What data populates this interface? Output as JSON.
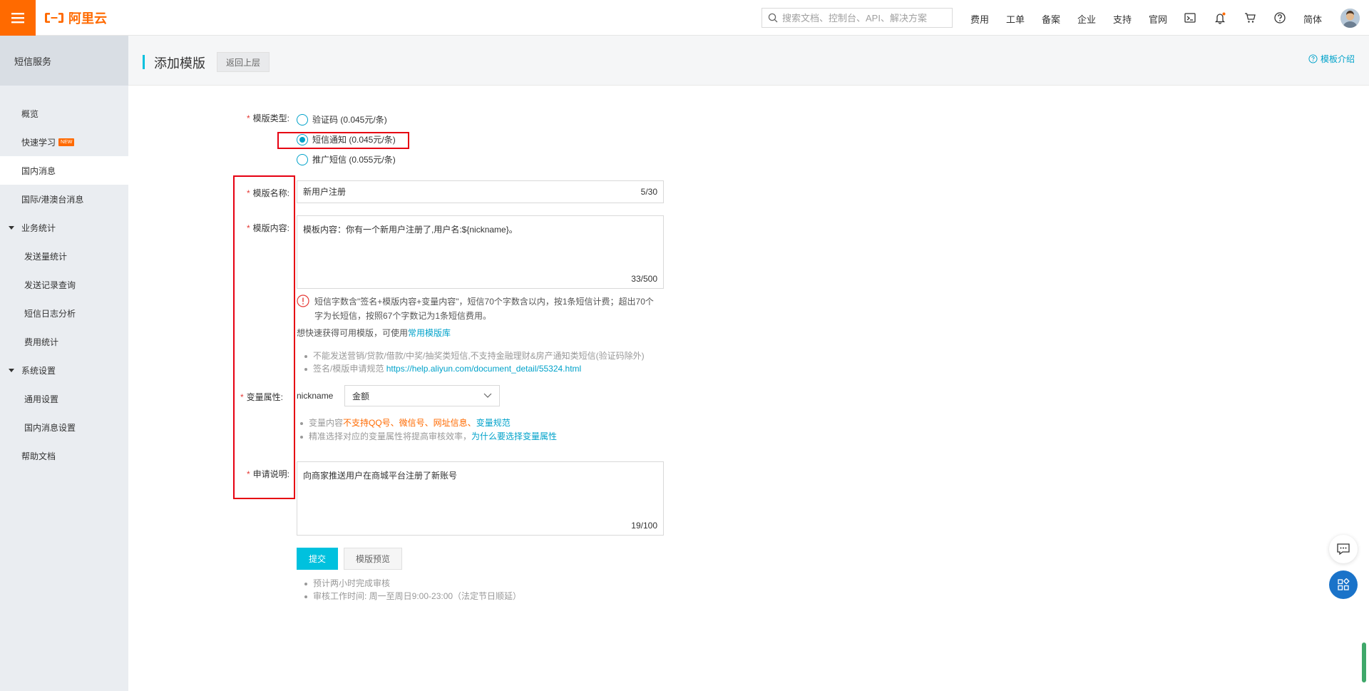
{
  "topbar": {
    "logo_text": "阿里云",
    "search_placeholder": "搜索文档、控制台、API、解决方案",
    "nav": [
      "费用",
      "工单",
      "备案",
      "企业",
      "支持",
      "官网"
    ],
    "lang": "简体"
  },
  "sidebar": {
    "title": "短信服务",
    "items": [
      {
        "label": "概览"
      },
      {
        "label": "快速学习",
        "badge": "NEW"
      },
      {
        "label": "国内消息"
      },
      {
        "label": "国际/港澳台消息"
      },
      {
        "label": "业务统计"
      },
      {
        "label": "发送量统计"
      },
      {
        "label": "发送记录查询"
      },
      {
        "label": "短信日志分析"
      },
      {
        "label": "费用统计"
      },
      {
        "label": "系统设置"
      },
      {
        "label": "通用设置"
      },
      {
        "label": "国内消息设置"
      },
      {
        "label": "帮助文档"
      }
    ]
  },
  "header": {
    "title": "添加模版",
    "back_label": "返回上层",
    "intro_label": "模板介绍"
  },
  "form": {
    "type_label": "模版类型:",
    "types": [
      {
        "label": "验证码 (0.045元/条)",
        "checked": false
      },
      {
        "label": "短信通知 (0.045元/条)",
        "checked": true
      },
      {
        "label": "推广短信 (0.055元/条)",
        "checked": false
      }
    ],
    "name_label": "模版名称:",
    "name_value": "新用户注册",
    "name_count": "5/30",
    "content_label": "模版内容:",
    "content_value": "模板内容：你有一个新用户注册了,用户名:${nickname}。",
    "content_count": "33/500",
    "warning_line1": "短信字数含\"签名+模版内容+变量内容\"，短信70个字数含以内，按1条短信计费；超出70个",
    "warning_line2": "字为长短信，按照67个字数记为1条短信费用。",
    "library_text": "想快速获得可用模版，可使用",
    "library_link": "常用模版库",
    "rule1": "不能发送营销/贷款/借款/中奖/抽奖类短信,不支持金融理财&房产通知类短信(验证码除外)",
    "rule2_prefix": "签名/模版申请规范",
    "rule2_link": "https://help.aliyun.com/document_detail/55324.html",
    "var_label": "变量属性:",
    "var_name": "nickname",
    "var_select": "金额",
    "var_hint1_prefix": "变量内容",
    "var_hint1_orange": "不支持QQ号、微信号、网址信息、",
    "var_hint1_link": "变量规范",
    "var_hint2_prefix": "精准选择对应的变量属性将提高审核效率，",
    "var_hint2_link": "为什么要选择变量属性",
    "desc_label": "申请说明:",
    "desc_value": "向商家推送用户在商城平台注册了新账号",
    "desc_count": "19/100",
    "submit_label": "提交",
    "preview_label": "模版预览",
    "note1": "预计两小时完成审核",
    "note2": "审核工作时间: 周一至周日9:00-23:00（法定节日顺延）"
  },
  "colors": {
    "brand": "#ff6a00",
    "accent": "#00c1de",
    "link": "#00a2ca",
    "highlight": "#e60012"
  }
}
